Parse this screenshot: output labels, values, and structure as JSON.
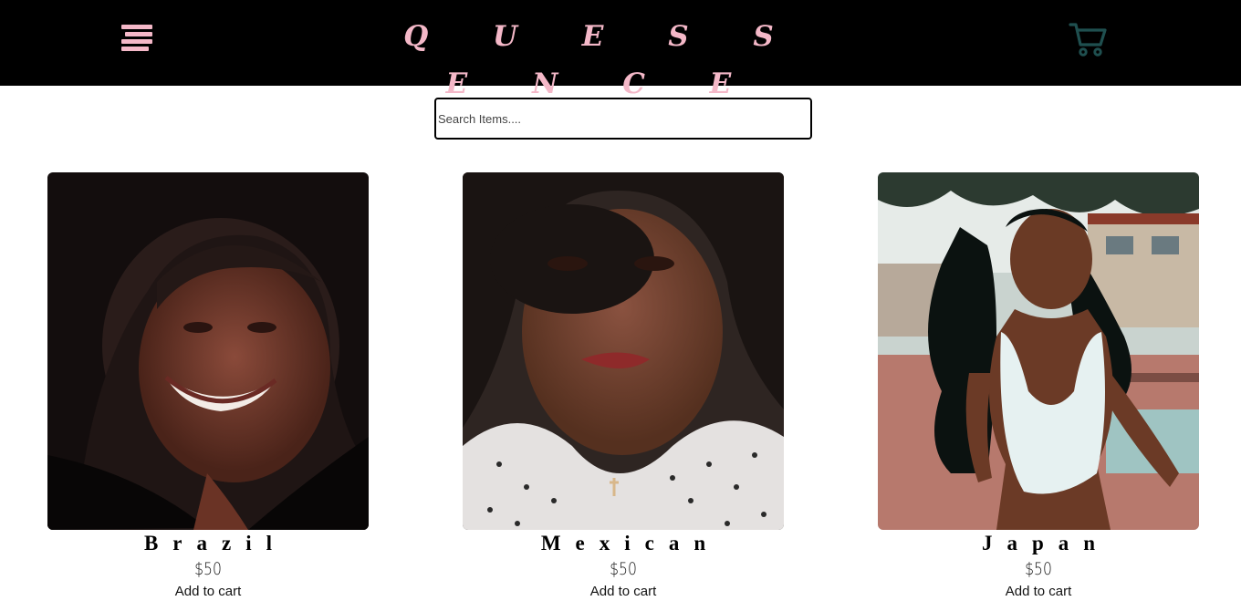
{
  "header": {
    "brand": "Q U E S S E N C E",
    "menu_icon": "hamburger-menu-icon",
    "cart_icon": "shopping-cart-icon",
    "colors": {
      "background": "#000000",
      "accent": "#f4b8c8",
      "cart": "#1f4f4f"
    }
  },
  "search": {
    "placeholder": "Search Items....",
    "value": ""
  },
  "products": [
    {
      "name": "Brazil",
      "price": "$50",
      "cta": "Add to cart"
    },
    {
      "name": "Mexican",
      "price": "$50",
      "cta": "Add to cart"
    },
    {
      "name": "Japan",
      "price": "$50",
      "cta": "Add to cart"
    }
  ]
}
